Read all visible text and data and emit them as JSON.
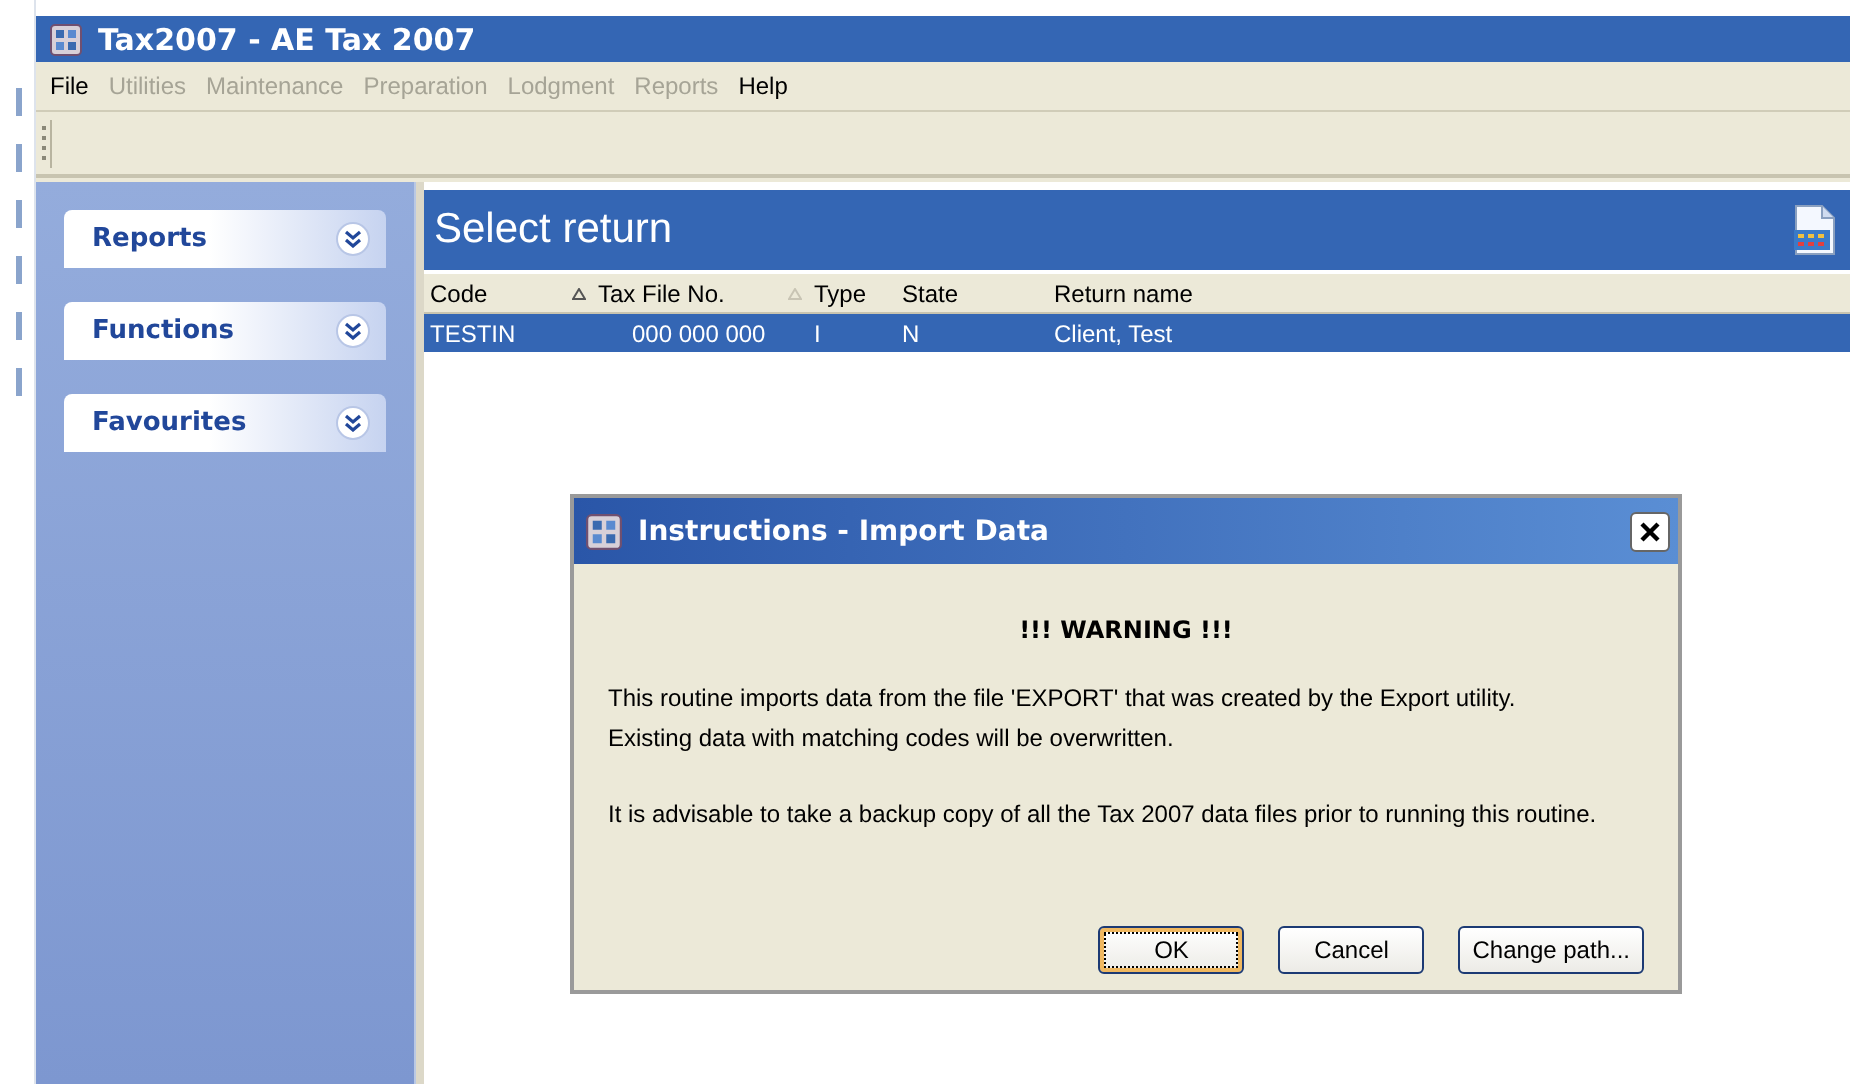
{
  "window": {
    "title": "Tax2007 - AE Tax 2007"
  },
  "menu": [
    {
      "label": "File",
      "disabled": false
    },
    {
      "label": "Utilities",
      "disabled": true
    },
    {
      "label": "Maintenance",
      "disabled": true
    },
    {
      "label": "Preparation",
      "disabled": true
    },
    {
      "label": "Lodgment",
      "disabled": true
    },
    {
      "label": "Reports",
      "disabled": true
    },
    {
      "label": "Help",
      "disabled": false
    }
  ],
  "sidebar": {
    "items": [
      {
        "label": "Reports",
        "expanded": false
      },
      {
        "label": "Functions",
        "expanded": false
      },
      {
        "label": "Favourites",
        "expanded": false
      }
    ]
  },
  "panel": {
    "title": "Select return"
  },
  "table": {
    "columns": [
      {
        "label": "Code",
        "sorted": true,
        "primary": true
      },
      {
        "label": "Tax File No.",
        "sorted": true,
        "primary": false
      },
      {
        "label": "Type",
        "sorted": false
      },
      {
        "label": "State",
        "sorted": false
      },
      {
        "label": "Return name",
        "sorted": false
      }
    ],
    "rows": [
      {
        "cells": [
          "TESTIN",
          "000 000 000",
          "I",
          "N",
          "Client, Test"
        ],
        "selected": true
      }
    ]
  },
  "dialog": {
    "title": "Instructions - Import Data",
    "heading": "!!! WARNING !!!",
    "paragraphs": [
      "This routine imports data from the file 'EXPORT' that was created by the Export utility.\nExisting data with matching codes will be overwritten.",
      "It is advisable to take a backup copy of all the Tax 2007 data files prior to running this routine."
    ],
    "buttons": [
      {
        "label": "OK",
        "default": true
      },
      {
        "label": "Cancel",
        "default": false
      },
      {
        "label": "Change path...",
        "default": false
      }
    ]
  }
}
